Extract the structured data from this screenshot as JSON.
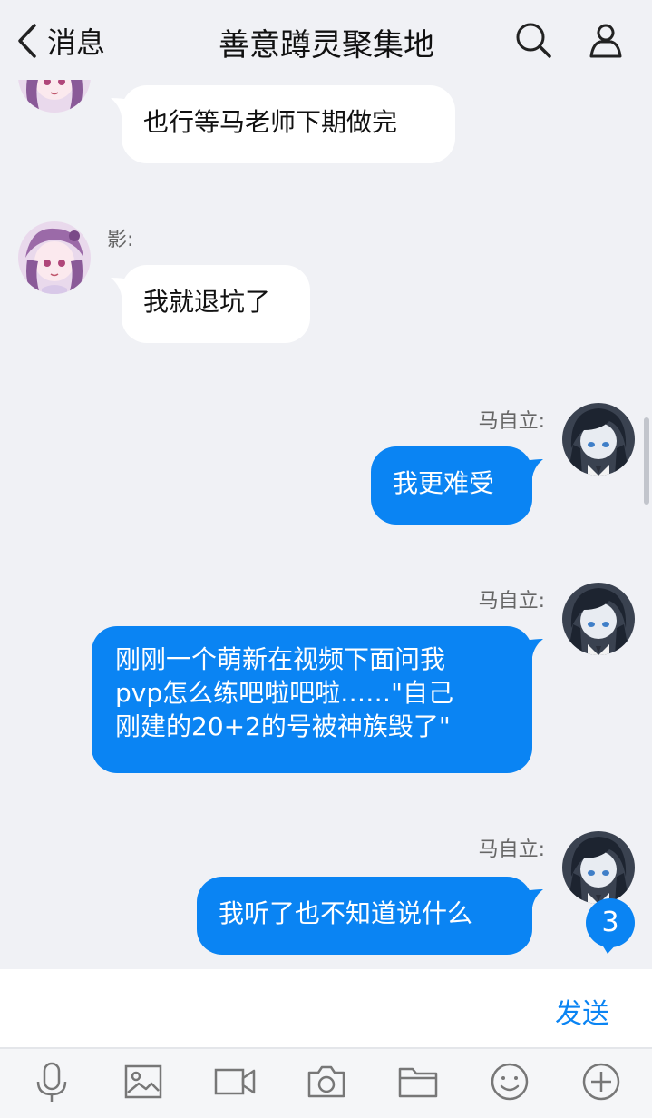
{
  "header": {
    "back_label": "消息",
    "title": "善意蹲灵聚集地"
  },
  "messages": [
    {
      "side": "left",
      "sender": "",
      "text": "也行等马老师下期做完"
    },
    {
      "side": "left",
      "sender": "影:",
      "text": "我就退坑了"
    },
    {
      "side": "right",
      "sender": "马自立:",
      "text": "我更难受"
    },
    {
      "side": "right",
      "sender": "马自立:",
      "lines": [
        "刚刚一个萌新在视频下面问我",
        "pvp怎么练吧啦吧啦……\"自己",
        "刚建的20+2的号被神族毁了\""
      ]
    },
    {
      "side": "right",
      "sender": "马自立:",
      "text": "我听了也不知道说什么"
    }
  ],
  "unread_count": "3",
  "composer": {
    "send_label": "发送",
    "value": ""
  },
  "toolbar": [
    "microphone-icon",
    "image-icon",
    "video-icon",
    "camera-icon",
    "folder-icon",
    "emoji-icon",
    "plus-icon"
  ],
  "colors": {
    "accent": "#0a84f3",
    "background": "#f0f1f5",
    "bubble_left": "#ffffff"
  }
}
